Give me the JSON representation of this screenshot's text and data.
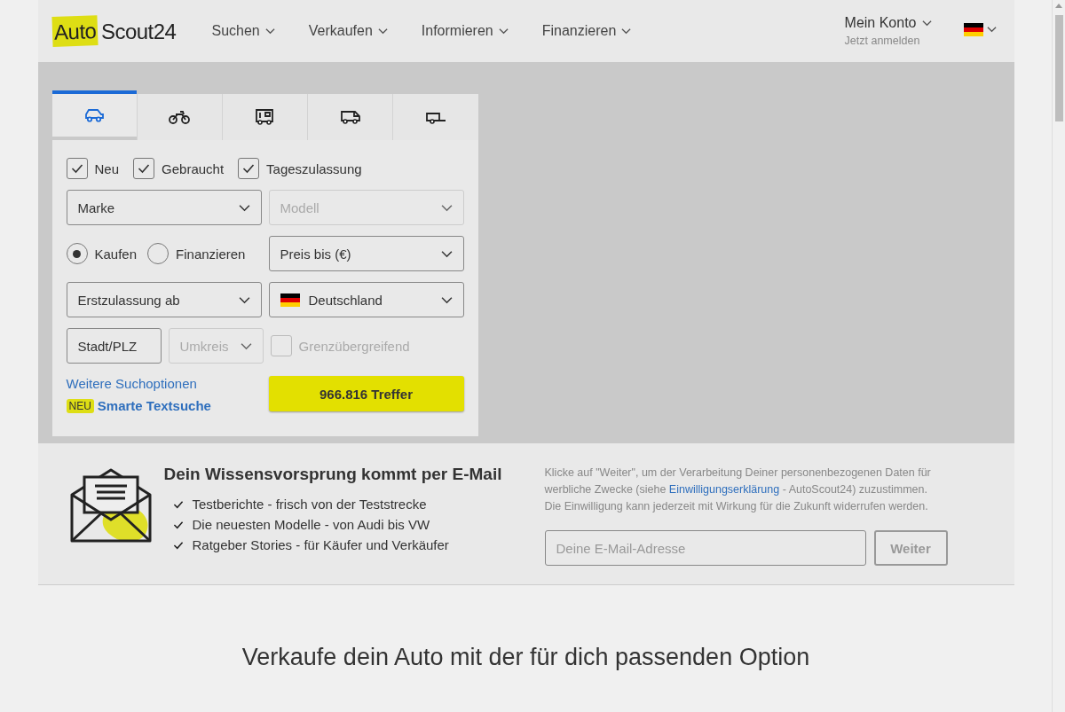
{
  "header": {
    "logo": {
      "highlighted": "Auto",
      "rest": "Scout24"
    },
    "nav": [
      {
        "label": "Suchen"
      },
      {
        "label": "Verkaufen"
      },
      {
        "label": "Informieren"
      },
      {
        "label": "Finanzieren"
      }
    ],
    "account": {
      "label": "Mein Konto",
      "sublabel": "Jetzt anmelden"
    }
  },
  "search": {
    "tabs": [
      {
        "kind": "car",
        "selected": true
      },
      {
        "kind": "motorbike",
        "selected": false
      },
      {
        "kind": "camper",
        "selected": false
      },
      {
        "kind": "van",
        "selected": false
      },
      {
        "kind": "trailer",
        "selected": false
      }
    ],
    "conditions": [
      {
        "label": "Neu",
        "checked": true
      },
      {
        "label": "Gebraucht",
        "checked": true
      },
      {
        "label": "Tageszulassung",
        "checked": true
      }
    ],
    "make_select": {
      "label": "Marke",
      "disabled": false
    },
    "model_select": {
      "label": "Modell",
      "disabled": true
    },
    "payment_options": [
      {
        "label": "Kaufen",
        "selected": true
      },
      {
        "label": "Finanzieren",
        "selected": false
      }
    ],
    "price_select": {
      "label": "Preis bis (€)",
      "disabled": false
    },
    "registration_select": {
      "label": "Erstzulassung ab",
      "disabled": false
    },
    "country_select": {
      "label": "Deutschland",
      "disabled": false
    },
    "city_field": {
      "placeholder": "Stadt/PLZ"
    },
    "radius_select": {
      "label": "Umkreis",
      "disabled": true
    },
    "cross_border": {
      "label": "Grenzübergreifend",
      "checked": false,
      "disabled": true
    },
    "more_options_link": "Weitere Suchoptionen",
    "new_badge": "NEU",
    "smart_search_link": "Smarte Textsuche",
    "results_button": "966.816 Treffer"
  },
  "newsletter": {
    "title": "Dein Wissensvorsprung kommt per E-Mail",
    "benefits": [
      "Testberichte - frisch von der Teststrecke",
      "Die neuesten Modelle - von Audi bis VW",
      "Ratgeber Stories - für Käufer und Verkäufer"
    ],
    "consent": {
      "before": "Klicke auf \"Weiter\", um der Verarbeitung Deiner personenbezogenen Daten für werbliche Zwecke (siehe ",
      "link": "Einwilligungserklärung",
      "after": " - AutoScout24) zuzustimmen."
    },
    "consent_note": "Die Einwilligung kann jederzeit mit Wirkung für die Zukunft widerrufen werden.",
    "email_field": {
      "placeholder": "Deine E-Mail-Adresse"
    },
    "submit_button": "Weiter"
  },
  "sell_section": {
    "title": "Verkaufe dein Auto mit der für dich passenden Option"
  }
}
